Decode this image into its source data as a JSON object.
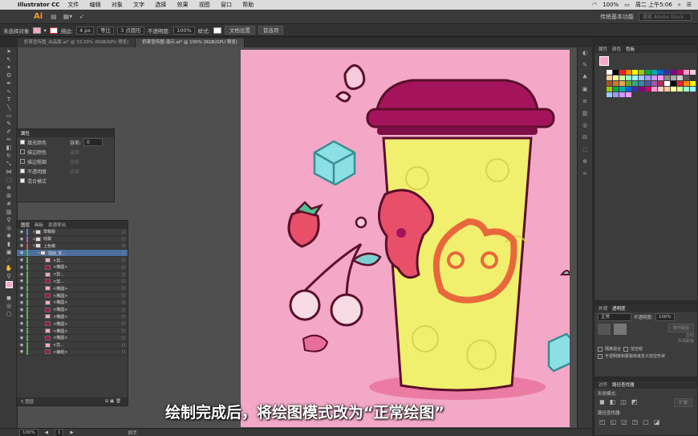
{
  "mac_menubar": {
    "app_name": "Illustrator CC",
    "menus": [
      "文件",
      "编辑",
      "对象",
      "文字",
      "选择",
      "效果",
      "视图",
      "窗口",
      "帮助"
    ],
    "battery": "100%",
    "clock": "周二 上午5:06"
  },
  "app_toolbar": {
    "logo": "Ai",
    "workspace": "传统基本功能",
    "search_placeholder": "搜索 Adobe Stock"
  },
  "control_bar": {
    "selection_label": "未选择对象",
    "stroke_label": "描边:",
    "stroke_value": "4 px",
    "stroke_style": "等比",
    "brush": "3 点圆形",
    "opacity_label": "不透明度:",
    "opacity_value": "100%",
    "style_label": "样式:",
    "doc_setup": "文档设置",
    "preferences": "首选项"
  },
  "document_tabs": [
    {
      "label": "奶茶宣传图_出品版.ai* @ 33.33% (RGB/GPU 预览)",
      "active": false
    },
    {
      "label": "奶茶宣传图-演示.ai* @ 100% (RGB/GPU 预览)",
      "active": true
    }
  ],
  "appearance_panel": {
    "title": "属性",
    "rows": [
      {
        "label": "填充颜色",
        "extra": "容差:",
        "value": "0",
        "checked": true
      },
      {
        "label": "描边颜色",
        "extra": "容差:",
        "value": "",
        "checked": false
      },
      {
        "label": "描边粗细",
        "extra": "容差:",
        "value": "",
        "checked": false
      },
      {
        "label": "不透明度",
        "extra": "容差:",
        "value": "",
        "checked": true
      },
      {
        "label": "混合模式",
        "extra": "",
        "value": "",
        "checked": true
      }
    ]
  },
  "layers_panel": {
    "tabs": [
      "图层",
      "画板",
      "资源导出"
    ],
    "rows": [
      {
        "name": "草稿版",
        "color": "#5a86d8",
        "indent": 1
      },
      {
        "name": "线稿",
        "color": "#b84fd8",
        "indent": 1
      },
      {
        "name": "上色稿",
        "color": "#d84f4f",
        "indent": 1
      },
      {
        "name": "插画_复...",
        "color": "#4fb84f",
        "indent": 2,
        "selected": true
      },
      {
        "name": "<剪...",
        "color": "#4fb84f",
        "indent": 3
      },
      {
        "name": "<椭圆>",
        "color": "#4fb84f",
        "indent": 3
      },
      {
        "name": "<剪...",
        "color": "#4fb84f",
        "indent": 3
      },
      {
        "name": "<剪...",
        "color": "#4fb84f",
        "indent": 3
      },
      {
        "name": "<椭圆>",
        "color": "#4fb84f",
        "indent": 3
      },
      {
        "name": "<椭圆>",
        "color": "#4fb84f",
        "indent": 3
      },
      {
        "name": "<椭圆>",
        "color": "#4fb84f",
        "indent": 3
      },
      {
        "name": "<椭圆>",
        "color": "#4fb84f",
        "indent": 3
      },
      {
        "name": "<椭圆>",
        "color": "#4fb84f",
        "indent": 3
      },
      {
        "name": "<椭圆>",
        "color": "#4fb84f",
        "indent": 3
      },
      {
        "name": "<椭圆>",
        "color": "#4fb84f",
        "indent": 3
      },
      {
        "name": "<椭圆>",
        "color": "#4fb84f",
        "indent": 3
      },
      {
        "name": "<剪...",
        "color": "#4fb84f",
        "indent": 3
      },
      {
        "name": "<编组>",
        "color": "#4fb84f",
        "indent": 3
      }
    ],
    "footer": "5 图层"
  },
  "swatches_panel": {
    "tabs": [
      "属性",
      "颜色",
      "色板"
    ]
  },
  "transparency_panel": {
    "tabs": [
      "外观",
      "透明度"
    ],
    "mode": "正常",
    "opacity_label": "不透明度:",
    "opacity_value": "100%",
    "btn_make_mask": "制作蒙版",
    "chk_clip": "剪切",
    "chk_invert": "反相蒙版",
    "chk_isolate": "隔离混合",
    "chk_knockout": "挖空组",
    "chk_opacity_mask": "不透明度和蒙版用来定义挖空形状"
  },
  "pathfinder_panel": {
    "tabs": [
      "对齐",
      "路径查找器"
    ],
    "shape_modes_label": "形状模式:",
    "expand_label": "扩展",
    "pathfinders_label": "路径查找器:"
  },
  "status_bar": {
    "zoom": "100%",
    "page": "1",
    "tool": "抓手"
  },
  "subtitle": "绘制完成后，将绘图模式改为“正常绘图”",
  "colors": {
    "artboard_pink": "#f3a8c8",
    "lid": "#a4145c",
    "cup": "#f1ef6e",
    "cup_pattern": "#d8cf4e",
    "outline": "#5a0f2a",
    "mascot": "#e8683c",
    "ice": "#8be0e6",
    "cherry": "#f7dbe4",
    "leaf": "#7ccfd0"
  }
}
